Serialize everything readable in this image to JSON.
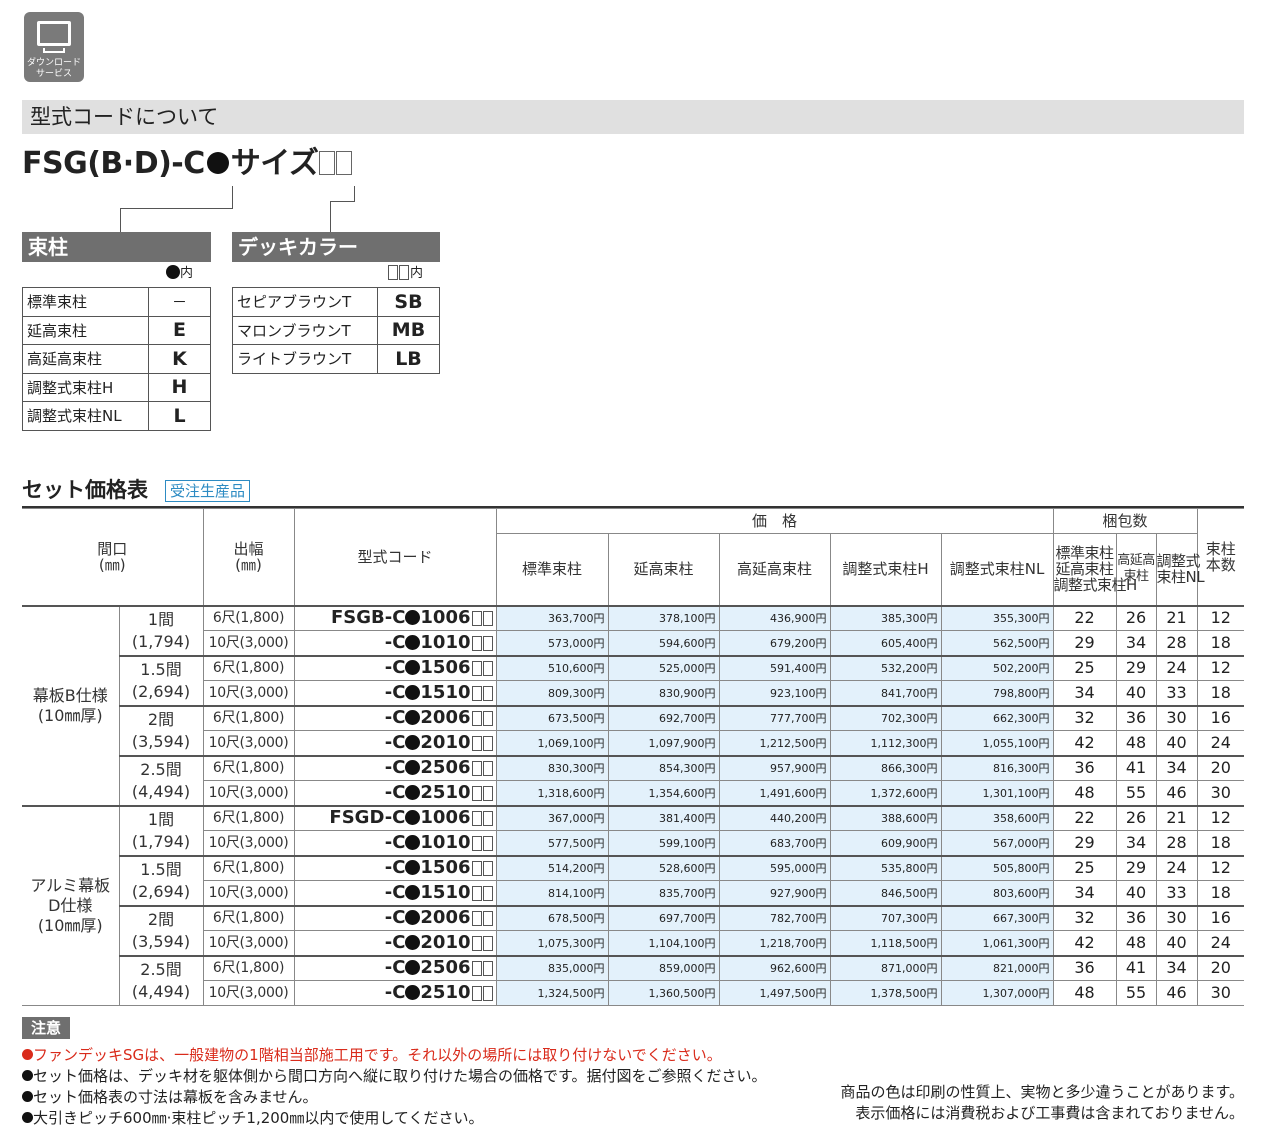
{
  "download": {
    "icon": "computer-monitor-icon",
    "label_1": "ダウンロード",
    "label_2": "サービス"
  },
  "section_title": "型式コードについて",
  "model_code": {
    "prefix": "FSG(B·D)-C",
    "suffix": "サイズ"
  },
  "pillar": {
    "title": "束柱",
    "note": "内",
    "rows": [
      {
        "name": "標準束柱",
        "code": "－"
      },
      {
        "name": "延高束柱",
        "code": "E"
      },
      {
        "name": "高延高束柱",
        "code": "K"
      },
      {
        "name": "調整式束柱H",
        "code": "H"
      },
      {
        "name": "調整式束柱NL",
        "code": "L"
      }
    ]
  },
  "deck_color": {
    "title": "デッキカラー",
    "note": "内",
    "rows": [
      {
        "name": "セピアブラウンT",
        "code": "SB"
      },
      {
        "name": "マロンブラウンT",
        "code": "MB"
      },
      {
        "name": "ライトブラウンT",
        "code": "LB"
      }
    ]
  },
  "price_table": {
    "title": "セット価格表",
    "tag": "受注生産品",
    "headers": {
      "frontage": "間口",
      "frontage_unit": "(㎜)",
      "projection": "出幅",
      "projection_unit": "(㎜)",
      "model_code": "型式コード",
      "price": "価　格",
      "price_cols": [
        "標準束柱",
        "延高束柱",
        "高延高束柱",
        "調整式束柱H",
        "調整式束柱NL"
      ],
      "package": "梱包数",
      "pkg_col1": [
        "標準束柱",
        "延高束柱",
        "調整式束柱H"
      ],
      "pkg_col2": [
        "高延高",
        "束柱"
      ],
      "pkg_col3": [
        "調整式",
        "束柱NL"
      ],
      "pillar_count": [
        "束柱",
        "本数"
      ]
    },
    "yen": "円",
    "groups": [
      {
        "spec": [
          "幕板B仕様",
          "(10㎜厚)"
        ],
        "sizes": [
          {
            "ma": "1間",
            "mm": "(1,794)",
            "rows": [
              {
                "width": "6尺(1,800)",
                "code_pre": "FSGB-C",
                "code_num": "1006",
                "prices": [
                  "363,700",
                  "378,100",
                  "436,900",
                  "385,300",
                  "355,300"
                ],
                "pkg": [
                  "22",
                  "26",
                  "21"
                ],
                "pillars": "12"
              },
              {
                "width": "10尺(3,000)",
                "code_pre": "-C",
                "code_num": "1010",
                "prices": [
                  "573,000",
                  "594,600",
                  "679,200",
                  "605,400",
                  "562,500"
                ],
                "pkg": [
                  "29",
                  "34",
                  "28"
                ],
                "pillars": "18"
              }
            ]
          },
          {
            "ma": "1.5間",
            "mm": "(2,694)",
            "rows": [
              {
                "width": "6尺(1,800)",
                "code_pre": "-C",
                "code_num": "1506",
                "prices": [
                  "510,600",
                  "525,000",
                  "591,400",
                  "532,200",
                  "502,200"
                ],
                "pkg": [
                  "25",
                  "29",
                  "24"
                ],
                "pillars": "12"
              },
              {
                "width": "10尺(3,000)",
                "code_pre": "-C",
                "code_num": "1510",
                "prices": [
                  "809,300",
                  "830,900",
                  "923,100",
                  "841,700",
                  "798,800"
                ],
                "pkg": [
                  "34",
                  "40",
                  "33"
                ],
                "pillars": "18"
              }
            ]
          },
          {
            "ma": "2間",
            "mm": "(3,594)",
            "rows": [
              {
                "width": "6尺(1,800)",
                "code_pre": "-C",
                "code_num": "2006",
                "prices": [
                  "673,500",
                  "692,700",
                  "777,700",
                  "702,300",
                  "662,300"
                ],
                "pkg": [
                  "32",
                  "36",
                  "30"
                ],
                "pillars": "16"
              },
              {
                "width": "10尺(3,000)",
                "code_pre": "-C",
                "code_num": "2010",
                "prices": [
                  "1,069,100",
                  "1,097,900",
                  "1,212,500",
                  "1,112,300",
                  "1,055,100"
                ],
                "pkg": [
                  "42",
                  "48",
                  "40"
                ],
                "pillars": "24"
              }
            ]
          },
          {
            "ma": "2.5間",
            "mm": "(4,494)",
            "rows": [
              {
                "width": "6尺(1,800)",
                "code_pre": "-C",
                "code_num": "2506",
                "prices": [
                  "830,300",
                  "854,300",
                  "957,900",
                  "866,300",
                  "816,300"
                ],
                "pkg": [
                  "36",
                  "41",
                  "34"
                ],
                "pillars": "20"
              },
              {
                "width": "10尺(3,000)",
                "code_pre": "-C",
                "code_num": "2510",
                "prices": [
                  "1,318,600",
                  "1,354,600",
                  "1,491,600",
                  "1,372,600",
                  "1,301,100"
                ],
                "pkg": [
                  "48",
                  "55",
                  "46"
                ],
                "pillars": "30"
              }
            ]
          }
        ]
      },
      {
        "spec": [
          "アルミ幕板",
          "D仕様",
          "(10㎜厚)"
        ],
        "sizes": [
          {
            "ma": "1間",
            "mm": "(1,794)",
            "rows": [
              {
                "width": "6尺(1,800)",
                "code_pre": "FSGD-C",
                "code_num": "1006",
                "prices": [
                  "367,000",
                  "381,400",
                  "440,200",
                  "388,600",
                  "358,600"
                ],
                "pkg": [
                  "22",
                  "26",
                  "21"
                ],
                "pillars": "12"
              },
              {
                "width": "10尺(3,000)",
                "code_pre": "-C",
                "code_num": "1010",
                "prices": [
                  "577,500",
                  "599,100",
                  "683,700",
                  "609,900",
                  "567,000"
                ],
                "pkg": [
                  "29",
                  "34",
                  "28"
                ],
                "pillars": "18"
              }
            ]
          },
          {
            "ma": "1.5間",
            "mm": "(2,694)",
            "rows": [
              {
                "width": "6尺(1,800)",
                "code_pre": "-C",
                "code_num": "1506",
                "prices": [
                  "514,200",
                  "528,600",
                  "595,000",
                  "535,800",
                  "505,800"
                ],
                "pkg": [
                  "25",
                  "29",
                  "24"
                ],
                "pillars": "12"
              },
              {
                "width": "10尺(3,000)",
                "code_pre": "-C",
                "code_num": "1510",
                "prices": [
                  "814,100",
                  "835,700",
                  "927,900",
                  "846,500",
                  "803,600"
                ],
                "pkg": [
                  "34",
                  "40",
                  "33"
                ],
                "pillars": "18"
              }
            ]
          },
          {
            "ma": "2間",
            "mm": "(3,594)",
            "rows": [
              {
                "width": "6尺(1,800)",
                "code_pre": "-C",
                "code_num": "2006",
                "prices": [
                  "678,500",
                  "697,700",
                  "782,700",
                  "707,300",
                  "667,300"
                ],
                "pkg": [
                  "32",
                  "36",
                  "30"
                ],
                "pillars": "16"
              },
              {
                "width": "10尺(3,000)",
                "code_pre": "-C",
                "code_num": "2010",
                "prices": [
                  "1,075,300",
                  "1,104,100",
                  "1,218,700",
                  "1,118,500",
                  "1,061,300"
                ],
                "pkg": [
                  "42",
                  "48",
                  "40"
                ],
                "pillars": "24"
              }
            ]
          },
          {
            "ma": "2.5間",
            "mm": "(4,494)",
            "rows": [
              {
                "width": "6尺(1,800)",
                "code_pre": "-C",
                "code_num": "2506",
                "prices": [
                  "835,000",
                  "859,000",
                  "962,600",
                  "871,000",
                  "821,000"
                ],
                "pkg": [
                  "36",
                  "41",
                  "34"
                ],
                "pillars": "20"
              },
              {
                "width": "10尺(3,000)",
                "code_pre": "-C",
                "code_num": "2510",
                "prices": [
                  "1,324,500",
                  "1,360,500",
                  "1,497,500",
                  "1,378,500",
                  "1,307,000"
                ],
                "pkg": [
                  "48",
                  "55",
                  "46"
                ],
                "pillars": "30"
              }
            ]
          }
        ]
      }
    ]
  },
  "notes": {
    "title": "注意",
    "items": [
      {
        "text": "ファンデッキSGは、一般建物の1階相当部施工用です。それ以外の場所には取り付けないでください。",
        "color": "#d92b1b"
      },
      {
        "text": "セット価格は、デッキ材を躯体側から間口方向へ縦に取り付けた場合の価格です。据付図をご参照ください。",
        "color": "#222222"
      },
      {
        "text": "セット価格表の寸法は幕板を含みません。",
        "color": "#222222"
      },
      {
        "text": "大引きピッチ600㎜·束柱ピッチ1,200㎜以内で使用してください。",
        "color": "#222222"
      }
    ],
    "right": [
      "商品の色は印刷の性質上、実物と多少違うことがあります。",
      "表示価格には消費税および工事費は含まれておりません。"
    ]
  }
}
